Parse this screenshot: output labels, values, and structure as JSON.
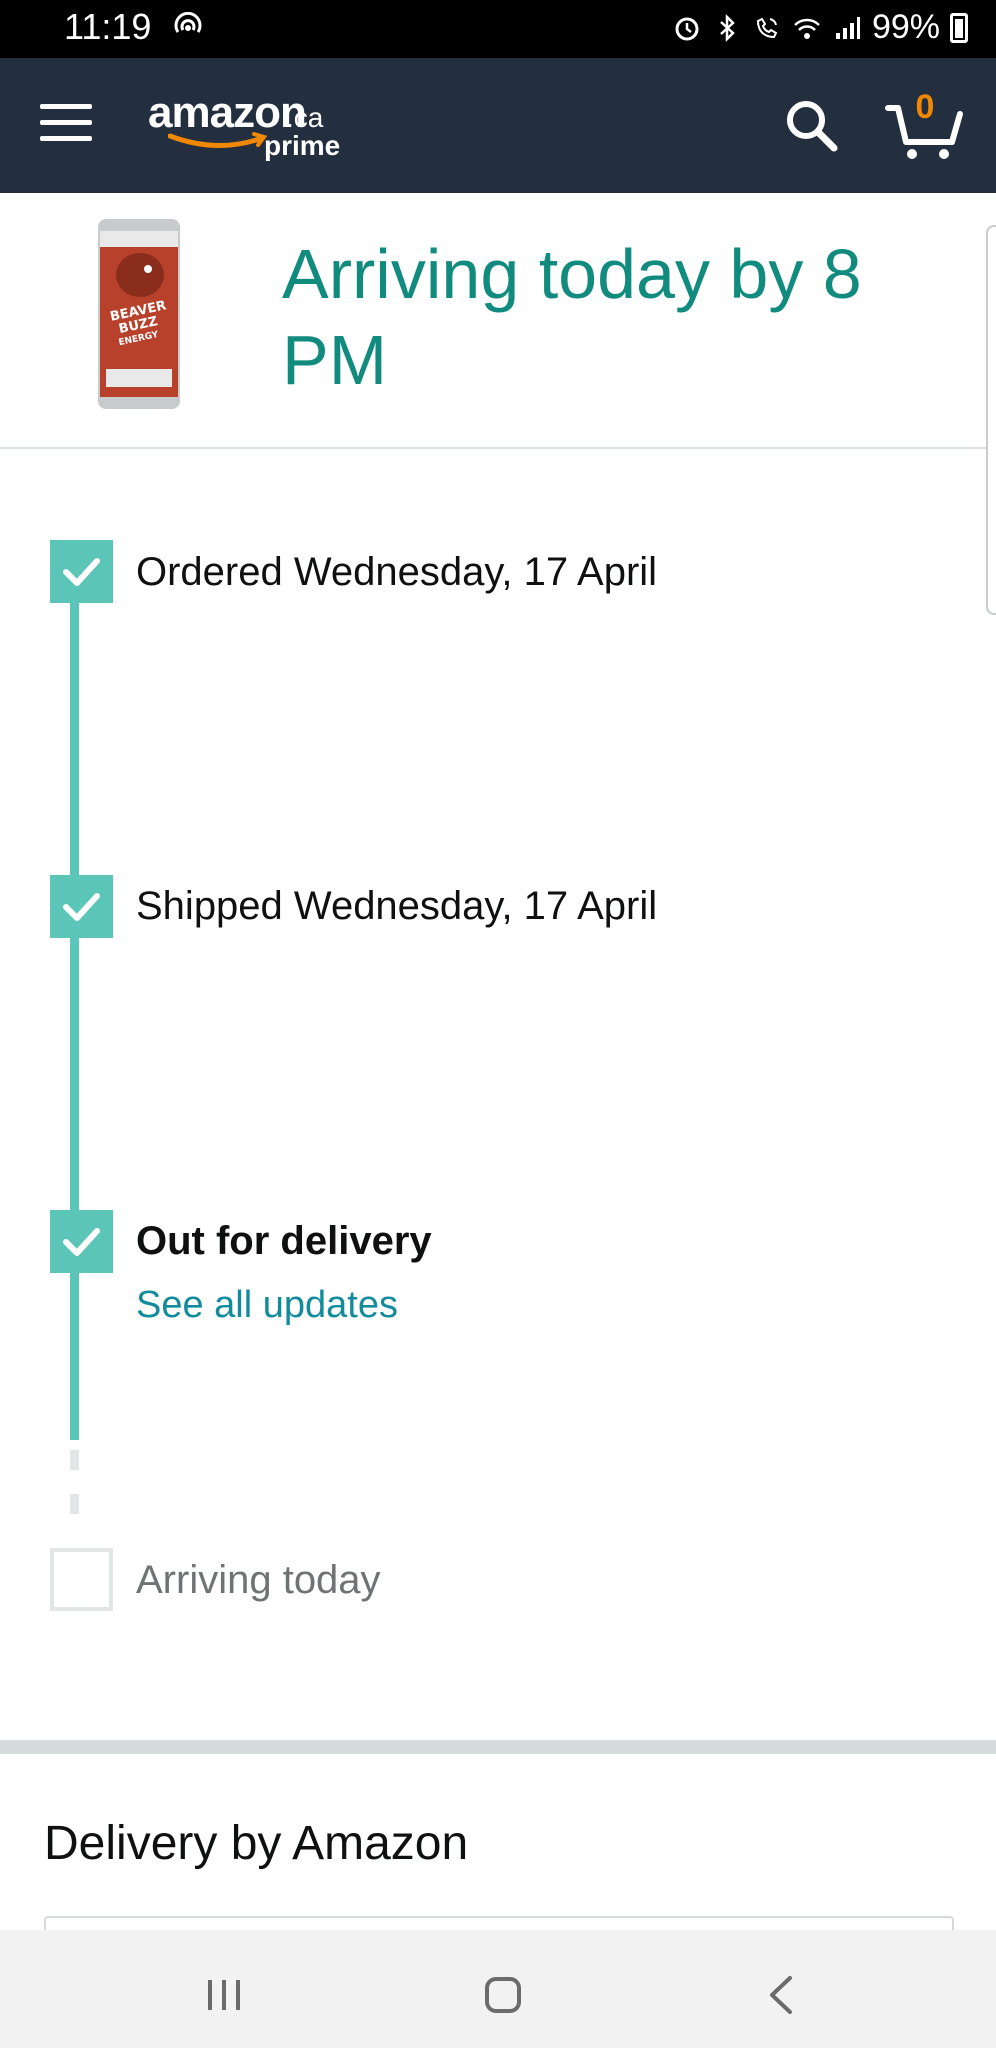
{
  "status_bar": {
    "time": "11:19",
    "battery": "99%",
    "icons": [
      "podcast-icon",
      "alarm-icon",
      "bluetooth-icon",
      "wifi-call-icon",
      "wifi-icon",
      "signal-icon",
      "battery-icon"
    ]
  },
  "header": {
    "logo_main": "amazon",
    "logo_suffix": ".ca",
    "logo_sub": "prime",
    "cart_count": "0",
    "brand_color": "#232f3e",
    "accent_color": "#f08804"
  },
  "shipment": {
    "title": "Arriving today by 8 PM",
    "product_label": "BEAVER BUZZ ENERGY",
    "title_color": "#128b7f"
  },
  "timeline": {
    "steps": [
      {
        "label": "Ordered Wednesday, 17 April",
        "done": true
      },
      {
        "label": "Shipped Wednesday, 17 April",
        "done": true
      },
      {
        "label": "Out for delivery",
        "done": true,
        "link": "See all updates"
      },
      {
        "label": "Arriving today",
        "done": false
      }
    ],
    "progress_color": "#5bc5b7"
  },
  "delivery": {
    "title": "Delivery by Amazon"
  }
}
